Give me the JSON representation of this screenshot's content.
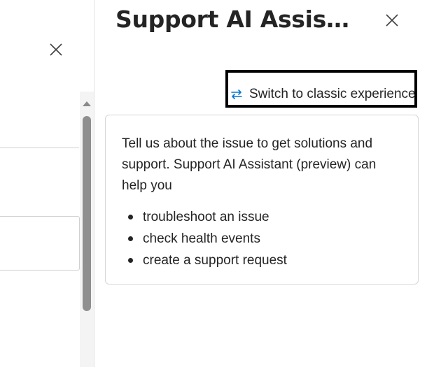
{
  "background_panel": {
    "close_icon": "close-icon",
    "scroll_up_icon": "chevron-up-icon"
  },
  "assistant_panel": {
    "title": "Support AI Assista...",
    "close_icon": "close-icon",
    "switch_link": {
      "icon": "swap-arrows-icon",
      "label": "Switch to classic experience"
    },
    "info_card": {
      "intro": "Tell us about the issue to get solutions and support. Support AI Assistant (preview) can help you",
      "items": [
        "troubleshoot an issue",
        "check health events",
        "create a support request"
      ]
    }
  },
  "colors": {
    "accent": "#0078d4",
    "text": "#242424",
    "border": "#d6d6d6",
    "highlight_border": "#000000"
  }
}
